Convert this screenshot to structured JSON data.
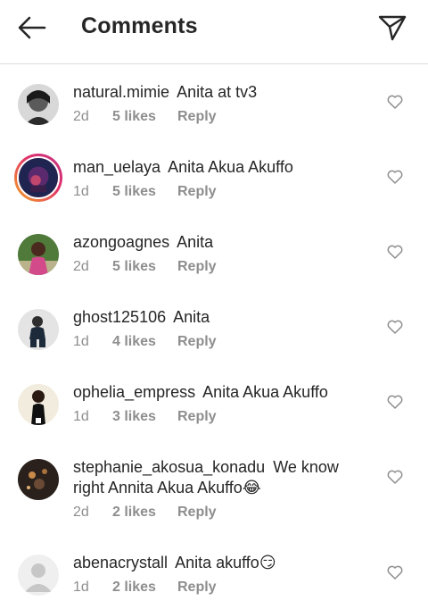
{
  "header": {
    "title": "Comments"
  },
  "comments": [
    {
      "username": "natural.mimie",
      "text": "Anita at tv3",
      "time": "2d",
      "likes": "5 likes",
      "reply": "Reply"
    },
    {
      "username": "man_uelaya",
      "text": "Anita Akua  Akuffo",
      "time": "1d",
      "likes": "5 likes",
      "reply": "Reply"
    },
    {
      "username": "azongoagnes",
      "text": "Anita",
      "time": "2d",
      "likes": "5 likes",
      "reply": "Reply"
    },
    {
      "username": "ghost125106",
      "text": "Anita",
      "time": "1d",
      "likes": "4 likes",
      "reply": "Reply"
    },
    {
      "username": "ophelia_empress",
      "text": "Anita Akua Akuffo",
      "time": "1d",
      "likes": "3 likes",
      "reply": "Reply"
    },
    {
      "username": "stephanie_akosua_konadu",
      "text": "We know right Annita Akua Akuffo😂",
      "time": "2d",
      "likes": "2 likes",
      "reply": "Reply"
    },
    {
      "username": "abenacrystall",
      "text": "Anita akuffo😏",
      "time": "1d",
      "likes": "2 likes",
      "reply": "Reply"
    }
  ],
  "icons": {
    "back": "arrow-left-icon",
    "send": "paper-plane-icon",
    "like": "heart-outline-icon"
  },
  "colors": {
    "text": "#262626",
    "meta": "#8e8e8e",
    "divider": "#dbdbdb",
    "story_ring_start": "#f5a623",
    "story_ring_end": "#c13584"
  }
}
